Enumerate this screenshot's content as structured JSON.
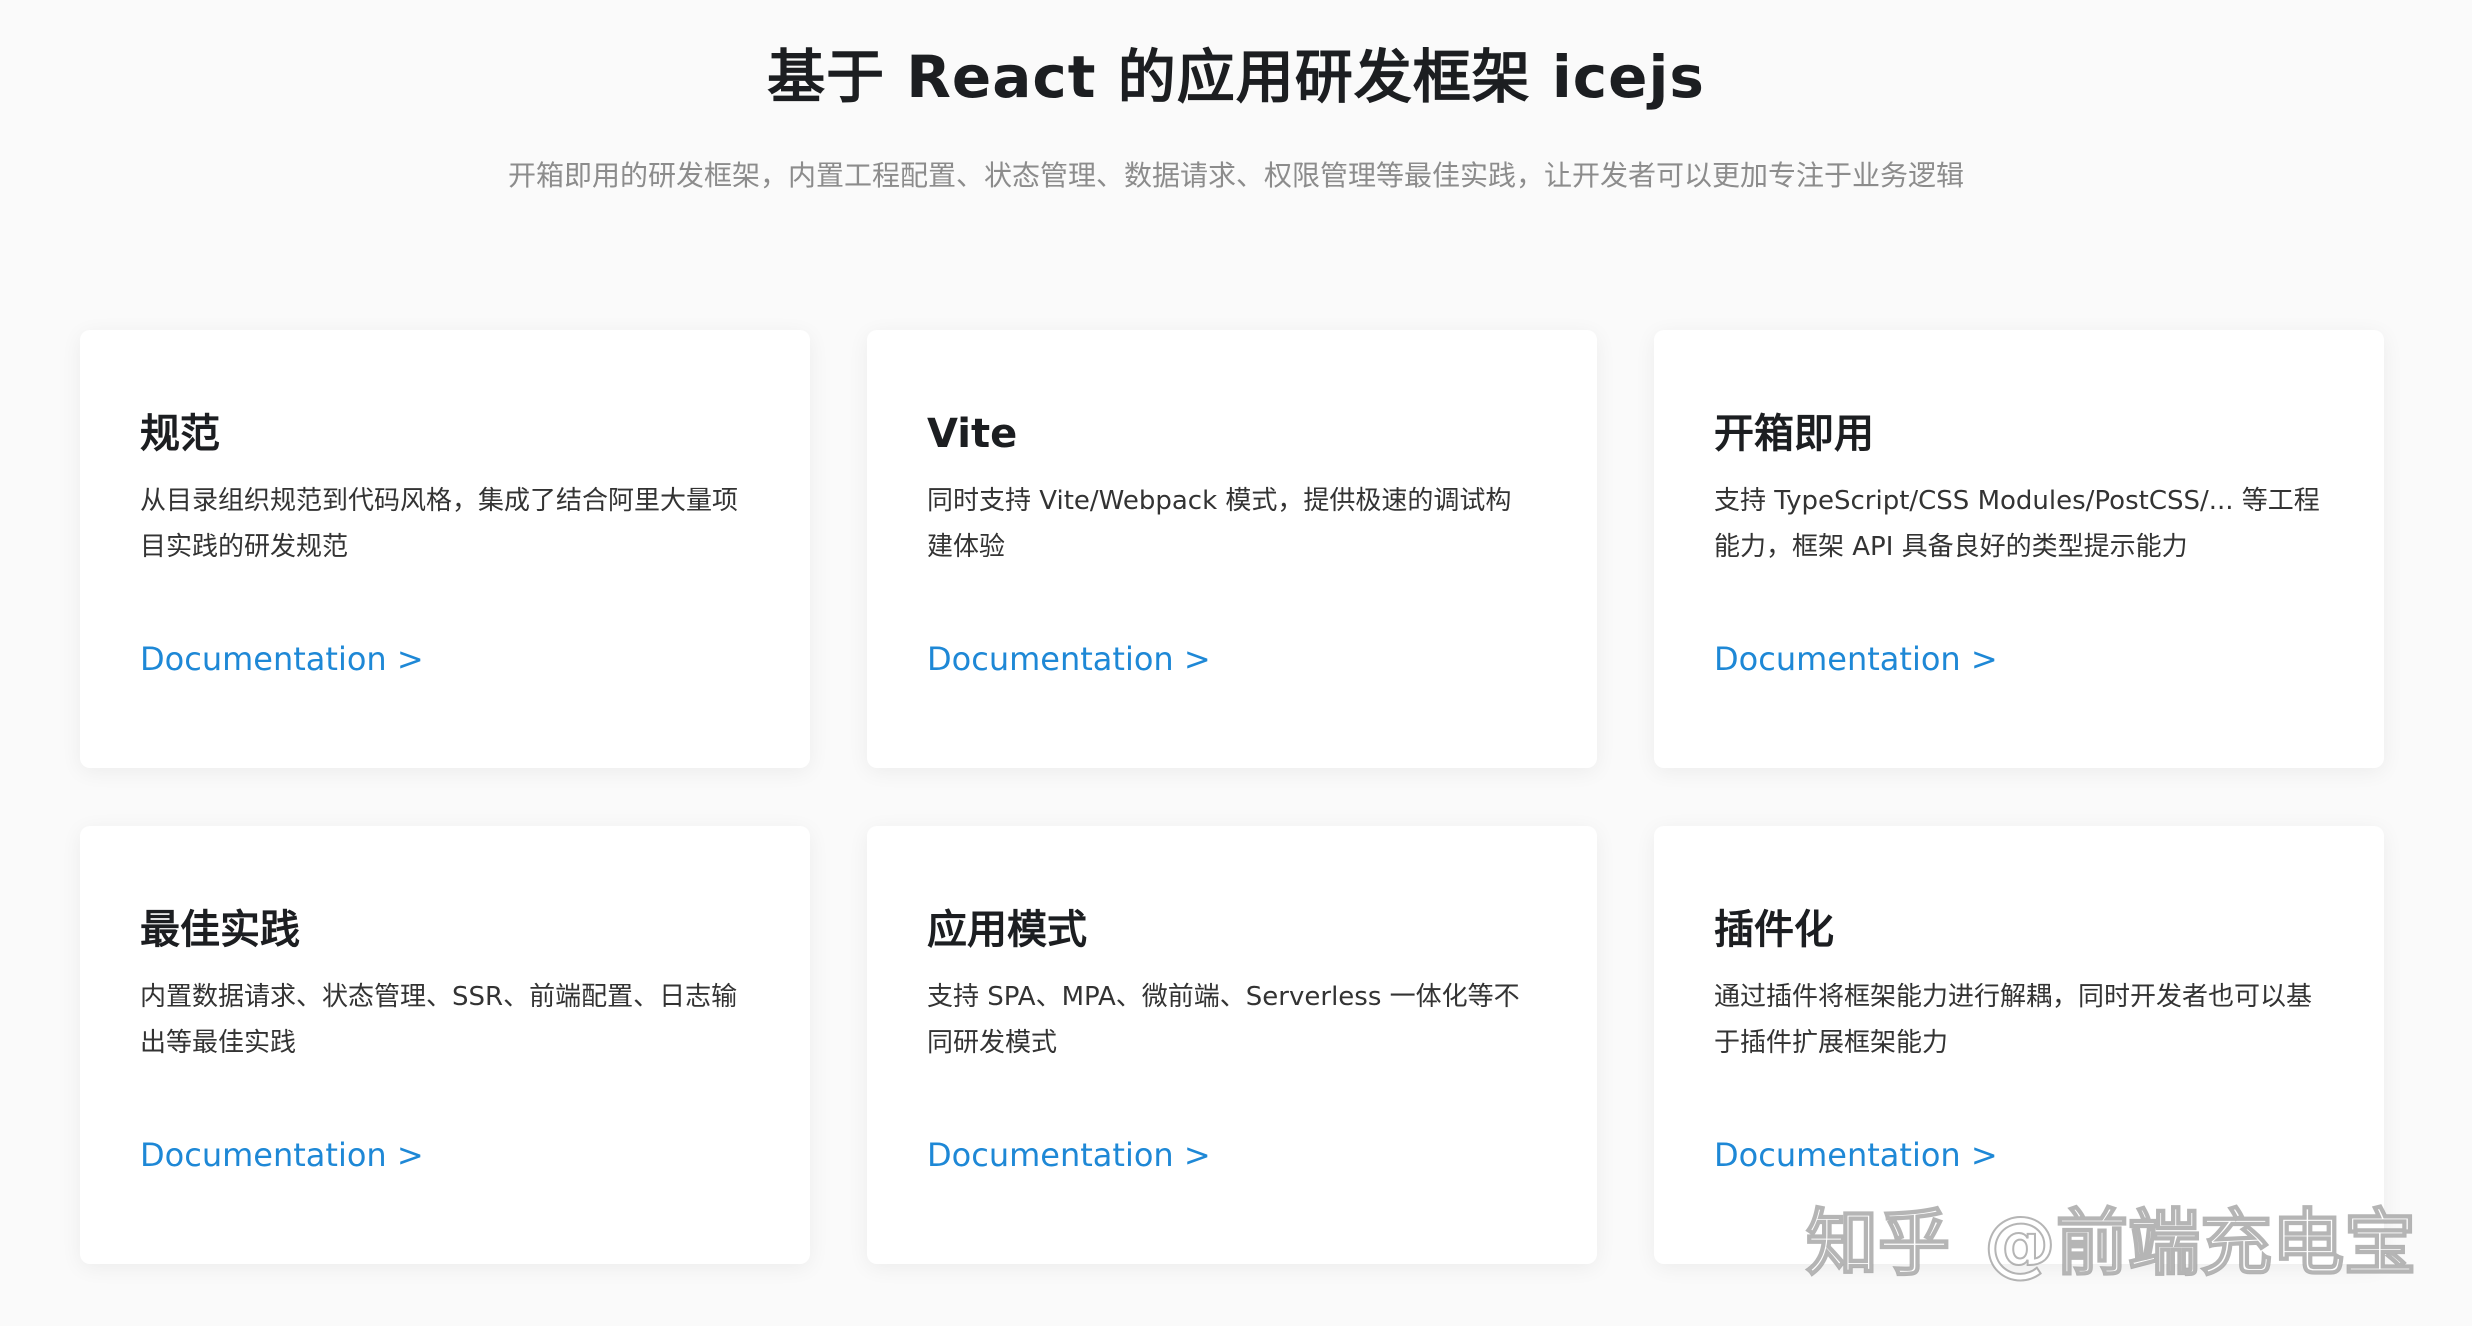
{
  "header": {
    "title": "基于 React 的应用研发框架 icejs",
    "subtitle": "开箱即用的研发框架，内置工程配置、状态管理、数据请求、权限管理等最佳实践，让开发者可以更加专注于业务逻辑"
  },
  "cards": [
    {
      "title": "规范",
      "description": "从目录组织规范到代码风格，集成了结合阿里大量项目实践的研发规范",
      "link": "Documentation >"
    },
    {
      "title": "Vite",
      "description": "同时支持 Vite/Webpack 模式，提供极速的调试构建体验",
      "link": "Documentation >"
    },
    {
      "title": "开箱即用",
      "description": "支持 TypeScript/CSS Modules/PostCSS/... 等工程能力，框架 API 具备良好的类型提示能力",
      "link": "Documentation >"
    },
    {
      "title": "最佳实践",
      "description": "内置数据请求、状态管理、SSR、前端配置、日志输出等最佳实践",
      "link": "Documentation >"
    },
    {
      "title": "应用模式",
      "description": "支持 SPA、MPA、微前端、Serverless 一体化等不同研发模式",
      "link": "Documentation >"
    },
    {
      "title": "插件化",
      "description": "通过插件将框架能力进行解耦，同时开发者也可以基于插件扩展框架能力",
      "link": "Documentation >"
    }
  ],
  "watermark": {
    "platform": "知乎",
    "author": "@前端充电宝"
  },
  "colors": {
    "background": "#fafafa",
    "card": "#ffffff",
    "link": "#1e88d6",
    "subtitle": "#8c8c8c"
  }
}
